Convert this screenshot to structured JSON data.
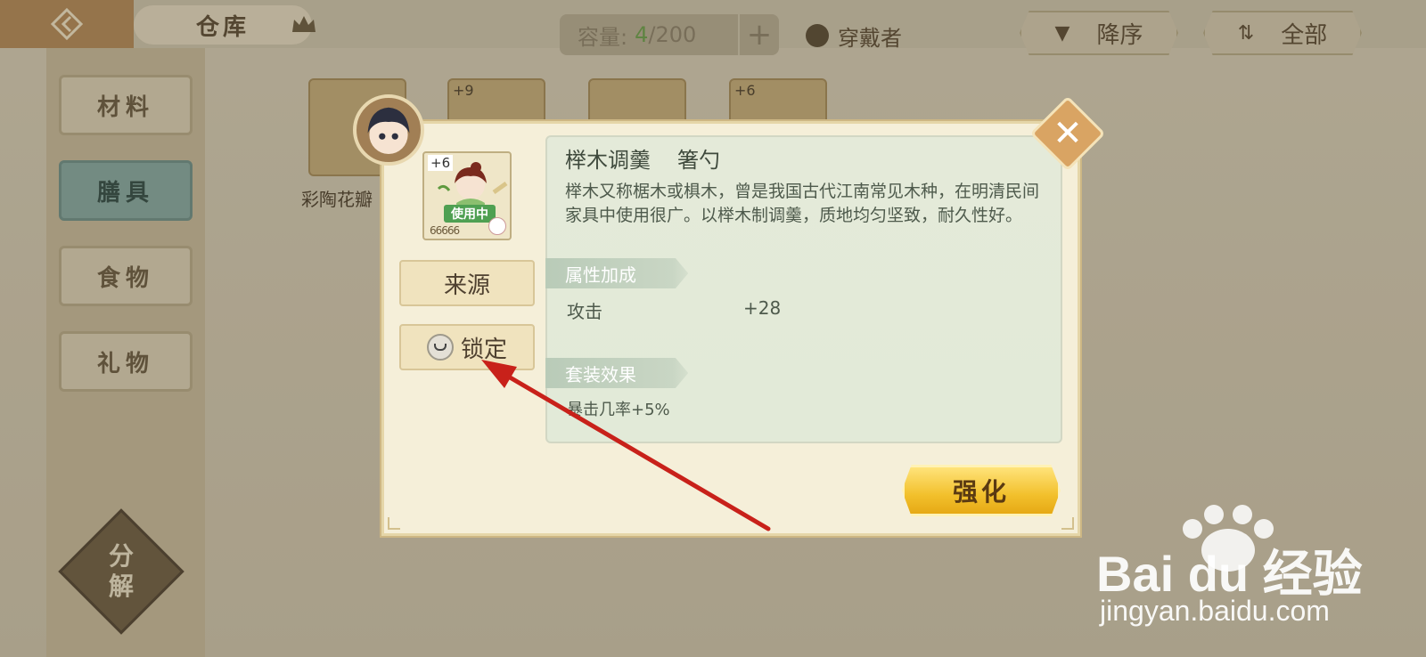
{
  "header": {
    "title": "仓库",
    "capacity_label": "容量:",
    "capacity_current": "4",
    "capacity_total": "/200",
    "capacity_add": "+",
    "wearer_label": "穿戴者",
    "sort_label": "降序",
    "filter_label": "全部"
  },
  "sidebar": {
    "tabs": [
      {
        "label": "材料"
      },
      {
        "label": "膳具"
      },
      {
        "label": "食物"
      },
      {
        "label": "礼物"
      }
    ],
    "active_tab": "膳具",
    "decompose_top": "分",
    "decompose_bottom": "解"
  },
  "grid": {
    "items": [
      {
        "level": ""
      },
      {
        "level": "+9"
      },
      {
        "level": ""
      },
      {
        "level": "+6"
      }
    ],
    "first_item_name": "彩陶花瓣"
  },
  "dialog": {
    "item_level": "+6",
    "in_use_badge": "使用中",
    "star_row": "66666",
    "source_button": "来源",
    "lock_button": "锁定",
    "item_name": "榉木调羹",
    "item_type": "箸勺",
    "description": "榉木又称椐木或椇木，曾是我国古代江南常见木种，在明清民间家具中使用很广。以榉木制调羹，质地均匀坚致，耐久性好。",
    "attr_section": "属性加成",
    "attr_name": "攻击",
    "attr_value": "+28",
    "set_section": "套装效果",
    "set_effect": "暴击几率+5%",
    "enhance_button": "强化",
    "close_symbol": "✕"
  },
  "watermark": {
    "brand": "Bai du 经验",
    "url": "jingyan.baidu.com"
  },
  "colors": {
    "accent_gold": "#f2c02c",
    "panel_green": "#e4ead9",
    "arrow_red": "#c8211a",
    "tab_active": "#86a9a3"
  }
}
